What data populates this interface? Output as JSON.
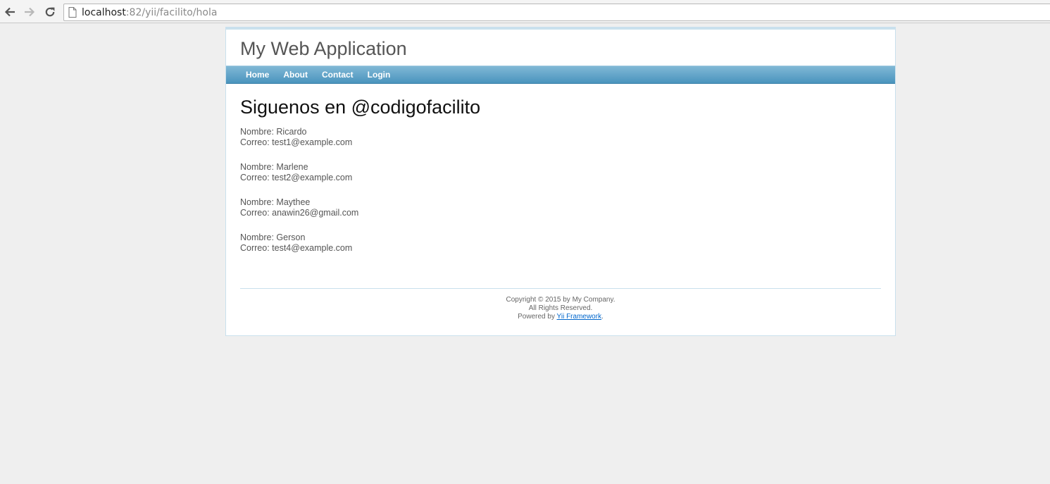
{
  "browser": {
    "url_host": "localhost",
    "url_path": ":82/yii/facilito/hola"
  },
  "site": {
    "name": "My Web Application"
  },
  "menu": {
    "items": [
      {
        "label": "Home"
      },
      {
        "label": "About"
      },
      {
        "label": "Contact"
      },
      {
        "label": "Login"
      }
    ]
  },
  "main": {
    "title": "Siguenos en @codigofacilito",
    "people": [
      {
        "name": "Nombre: Ricardo",
        "email": "Correo: test1@example.com"
      },
      {
        "name": "Nombre: Marlene",
        "email": "Correo: test2@example.com"
      },
      {
        "name": "Nombre: Maythee",
        "email": "Correo: anawin26@gmail.com"
      },
      {
        "name": "Nombre: Gerson",
        "email": "Correo: test4@example.com"
      }
    ]
  },
  "footer": {
    "copyright": "Copyright © 2015 by My Company.",
    "rights": "All Rights Reserved.",
    "powered_prefix": "Powered by ",
    "powered_link": "Yii Framework",
    "powered_suffix": "."
  },
  "colors": {
    "menu_bar": "#4a94bd",
    "page_border": "#c9e0ed",
    "background": "#efefef"
  }
}
